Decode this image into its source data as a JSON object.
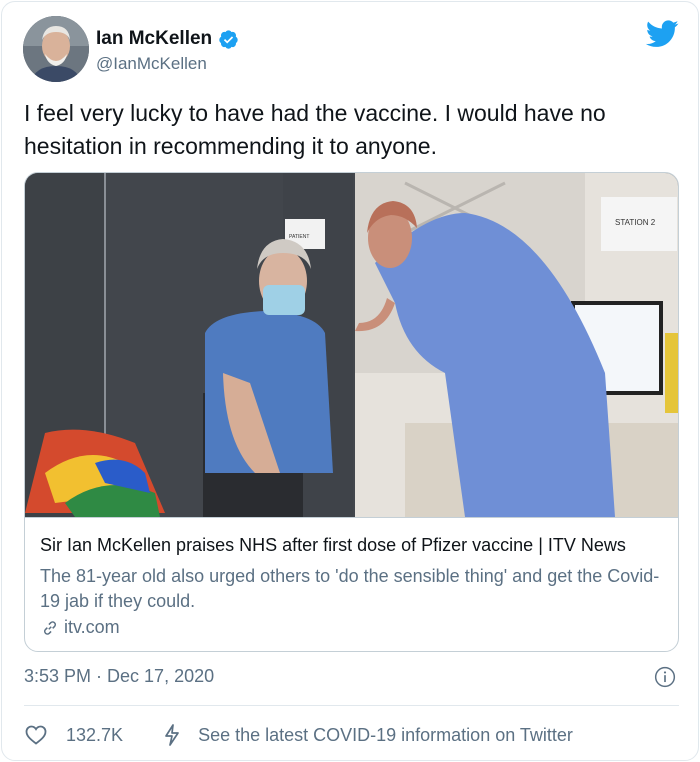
{
  "author": {
    "name": "Ian McKellen",
    "handle": "@IanMcKellen",
    "verified_icon": "verified-badge-icon",
    "avatar_icon": "avatar-photo"
  },
  "tweet": {
    "text": "I feel very lucky to have had the vaccine. I would have no hesitation in recommending it to anyone.",
    "timestamp": "3:53 PM · Dec 17, 2020"
  },
  "card": {
    "title": "Sir Ian McKellen praises NHS after first dose of Pfizer vaccine | ITV News",
    "description": "The 81-year old also urged others to 'do the sensible thing' and get the Covid-19 jab if they could.",
    "domain": "itv.com",
    "image_sign_patient": "PATIENT",
    "image_sign_station": "STATION 2"
  },
  "actions": {
    "likes": "132.7K",
    "covid_info": "See the latest COVID-19 information on Twitter"
  },
  "colors": {
    "twitter_blue": "#1da1f2",
    "secondary_text": "#5b7083",
    "border": "#e1e8ed"
  }
}
